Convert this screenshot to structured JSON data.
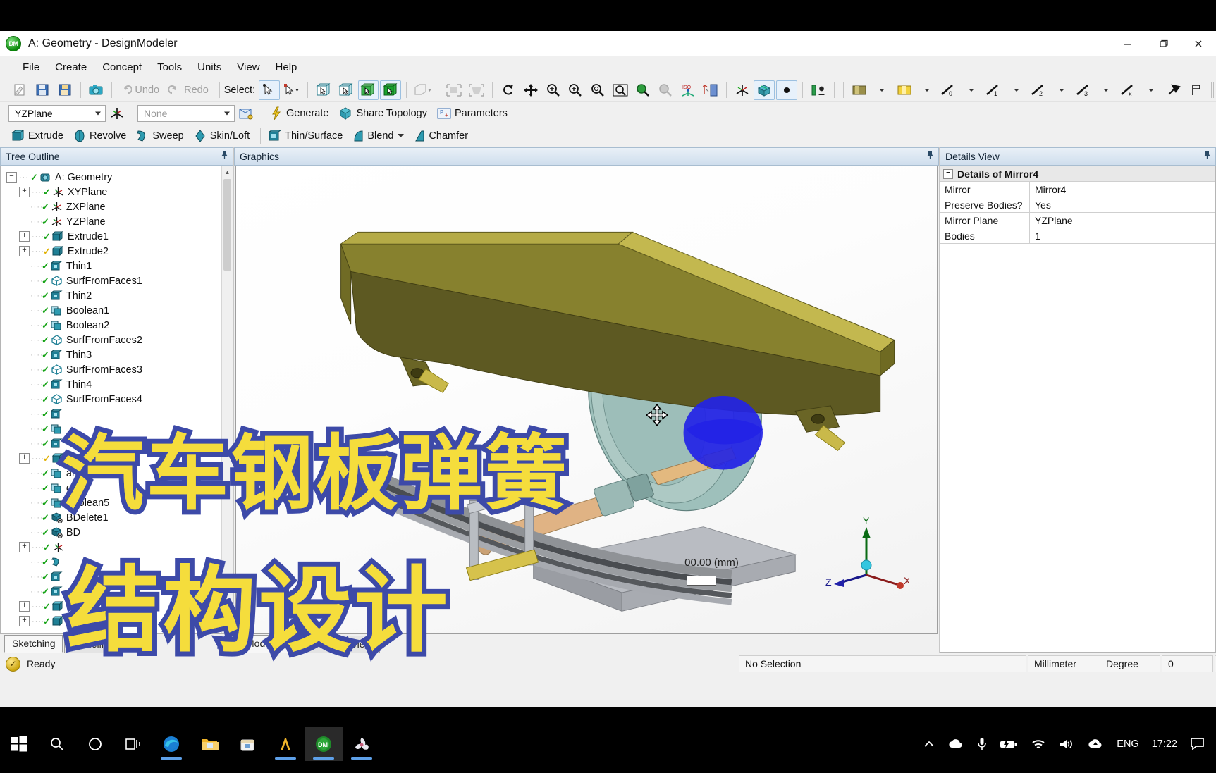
{
  "window": {
    "title": "A: Geometry - DesignModeler",
    "logo": "dm-logo",
    "minimize": "—",
    "maximize": "❐",
    "close": "✕"
  },
  "menubar": [
    "File",
    "Create",
    "Concept",
    "Tools",
    "Units",
    "View",
    "Help"
  ],
  "toolbar_row1": {
    "undo": "Undo",
    "redo": "Redo",
    "select_label": "Select:"
  },
  "toolbar_row2": {
    "plane_value": "YZPlane",
    "sketch_value": "None",
    "generate": "Generate",
    "share_topology": "Share Topology",
    "parameters": "Parameters"
  },
  "toolbar_row3": {
    "items": [
      "Extrude",
      "Revolve",
      "Sweep",
      "Skin/Loft",
      "Thin/Surface",
      "Blend",
      "Chamfer"
    ]
  },
  "tree": {
    "header": "Tree Outline",
    "pin": "pin-icon",
    "items": [
      {
        "label": "A: Geometry",
        "depth": 0,
        "expander": "-",
        "check": "green",
        "icon": "geometry-icon"
      },
      {
        "label": "XYPlane",
        "depth": 1,
        "expander": "+",
        "check": "green",
        "icon": "plane-icon"
      },
      {
        "label": "ZXPlane",
        "depth": 1,
        "expander": "",
        "check": "green",
        "icon": "plane-icon"
      },
      {
        "label": "YZPlane",
        "depth": 1,
        "expander": "",
        "check": "green",
        "icon": "plane-icon"
      },
      {
        "label": "Extrude1",
        "depth": 1,
        "expander": "+",
        "check": "green",
        "icon": "extrude-icon"
      },
      {
        "label": "Extrude2",
        "depth": 1,
        "expander": "+",
        "check": "yellow",
        "icon": "extrude-icon"
      },
      {
        "label": "Thin1",
        "depth": 1,
        "expander": "",
        "check": "green",
        "icon": "thin-icon"
      },
      {
        "label": "SurfFromFaces1",
        "depth": 1,
        "expander": "",
        "check": "green",
        "icon": "surf-icon"
      },
      {
        "label": "Thin2",
        "depth": 1,
        "expander": "",
        "check": "green",
        "icon": "thin-icon"
      },
      {
        "label": "Boolean1",
        "depth": 1,
        "expander": "",
        "check": "green",
        "icon": "boolean-icon"
      },
      {
        "label": "Boolean2",
        "depth": 1,
        "expander": "",
        "check": "green",
        "icon": "boolean-icon"
      },
      {
        "label": "SurfFromFaces2",
        "depth": 1,
        "expander": "",
        "check": "green",
        "icon": "surf-icon"
      },
      {
        "label": "Thin3",
        "depth": 1,
        "expander": "",
        "check": "green",
        "icon": "thin-icon"
      },
      {
        "label": "SurfFromFaces3",
        "depth": 1,
        "expander": "",
        "check": "green",
        "icon": "surf-icon"
      },
      {
        "label": "Thin4",
        "depth": 1,
        "expander": "",
        "check": "green",
        "icon": "thin-icon"
      },
      {
        "label": "SurfFromFaces4",
        "depth": 1,
        "expander": "",
        "check": "green",
        "icon": "surf-icon"
      },
      {
        "label": "",
        "depth": 1,
        "expander": "",
        "check": "green",
        "icon": "thin-icon"
      },
      {
        "label": "",
        "depth": 1,
        "expander": "",
        "check": "green",
        "icon": "boolean-icon"
      },
      {
        "label": "",
        "depth": 1,
        "expander": "",
        "check": "green",
        "icon": "thin-icon"
      },
      {
        "label": "",
        "depth": 1,
        "expander": "+",
        "check": "yellow",
        "icon": "extrude-icon"
      },
      {
        "label": "an3",
        "depth": 1,
        "expander": "",
        "check": "green",
        "icon": "boolean-icon"
      },
      {
        "label": "ean4",
        "depth": 1,
        "expander": "",
        "check": "green",
        "icon": "boolean-icon"
      },
      {
        "label": "Boolean5",
        "depth": 1,
        "expander": "",
        "check": "green",
        "icon": "boolean-icon"
      },
      {
        "label": "BDelete1",
        "depth": 1,
        "expander": "",
        "check": "green",
        "icon": "bdelete-icon"
      },
      {
        "label": "BD",
        "depth": 1,
        "expander": "",
        "check": "green",
        "icon": "bdelete-icon"
      },
      {
        "label": "",
        "depth": 1,
        "expander": "+",
        "check": "green",
        "icon": "plane-icon"
      },
      {
        "label": "",
        "depth": 1,
        "expander": "",
        "check": "green",
        "icon": "sweep-icon"
      },
      {
        "label": "",
        "depth": 1,
        "expander": "",
        "check": "green",
        "icon": "thin-icon"
      },
      {
        "label": "",
        "depth": 1,
        "expander": "",
        "check": "green",
        "icon": "thin-icon"
      },
      {
        "label": "",
        "depth": 1,
        "expander": "+",
        "check": "green",
        "icon": "extrude-icon"
      },
      {
        "label": "",
        "depth": 1,
        "expander": "+",
        "check": "green",
        "icon": "extrude-icon"
      }
    ],
    "tabs": [
      {
        "label": "Sketching",
        "active": true
      },
      {
        "label": "Modeling",
        "active": false
      }
    ]
  },
  "graphics": {
    "header": "Graphics",
    "pin": "pin-icon",
    "scale_label": "00.00 (mm)",
    "axis": {
      "x": "X",
      "y": "Y",
      "z": "Z"
    },
    "tabs": [
      {
        "label": "Model View",
        "active": true
      },
      {
        "label": "Print Preview",
        "active": false
      }
    ]
  },
  "details": {
    "header": "Details View",
    "pin": "pin-icon",
    "group_title": "Details of Mirror4",
    "rows": [
      {
        "key": "Mirror",
        "value": "Mirror4"
      },
      {
        "key": "Preserve Bodies?",
        "value": "Yes"
      },
      {
        "key": "Mirror Plane",
        "value": "YZPlane"
      },
      {
        "key": "Bodies",
        "value": "1"
      }
    ]
  },
  "status": {
    "ready": "Ready",
    "selection": "No Selection",
    "units_length": "Millimeter",
    "units_angle": "Degree",
    "count1": "0",
    "count2": "0"
  },
  "taskbar": {
    "items": [
      {
        "name": "start-button",
        "icon": "windows-logo"
      },
      {
        "name": "search",
        "icon": "search-icon"
      },
      {
        "name": "cortana",
        "icon": "circle-icon"
      },
      {
        "name": "task-view",
        "icon": "task-view-icon"
      },
      {
        "name": "edge",
        "icon": "edge-icon"
      },
      {
        "name": "file-explorer",
        "icon": "folder-icon"
      },
      {
        "name": "store",
        "icon": "store-icon"
      },
      {
        "name": "ansys",
        "icon": "ansys-icon"
      },
      {
        "name": "designmodeler",
        "icon": "dm-icon"
      },
      {
        "name": "photos",
        "icon": "photos-icon"
      }
    ],
    "tray": {
      "chevron": "^",
      "cloud": "cloud-icon",
      "mic": "mic-icon",
      "battery": "battery-icon",
      "wifi": "wifi-icon",
      "volume": "volume-icon",
      "onedrive": "onedrive-icon",
      "language": "ENG",
      "time": "17:22",
      "action_center": "notification-icon"
    }
  },
  "overlay": {
    "line1": "汽车钢板弹簧",
    "line2": "结构设计",
    "fill_color": "#f5dd3c",
    "stroke_color": "#3d4aa8"
  }
}
